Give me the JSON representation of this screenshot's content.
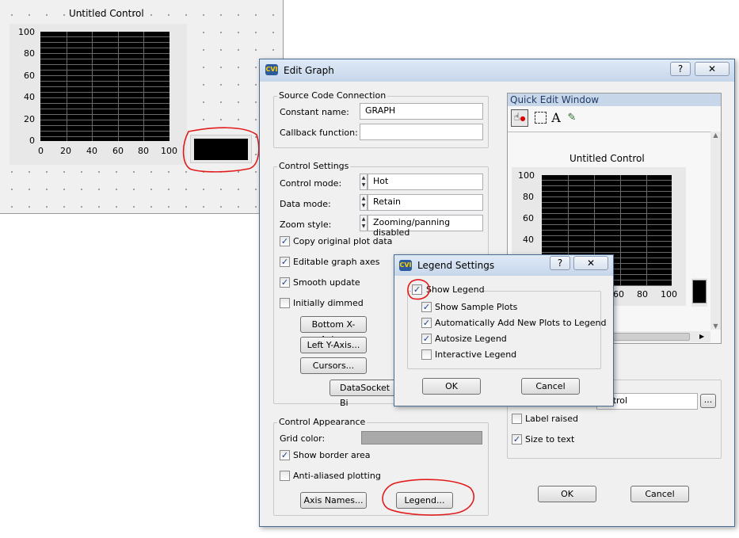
{
  "panel": {
    "control_title": "Untitled Control",
    "y_ticks": [
      "100",
      "80",
      "60",
      "40",
      "20",
      "0"
    ],
    "x_ticks": [
      "0",
      "20",
      "40",
      "60",
      "80",
      "100"
    ]
  },
  "edit_graph": {
    "title": "Edit Graph",
    "help_btn": "?",
    "close_btn": "✕",
    "source_group": "Source Code Connection",
    "constant_label": "Constant name:",
    "constant_value": "GRAPH",
    "callback_label": "Callback function:",
    "callback_value": "",
    "control_settings_group": "Control Settings",
    "control_mode_label": "Control mode:",
    "control_mode_value": "Hot",
    "data_mode_label": "Data mode:",
    "data_mode_value": "Retain",
    "zoom_label": "Zoom style:",
    "zoom_value": "Zooming/panning disabled",
    "cb_copy": "Copy original plot data",
    "cb_editable": "Editable graph axes",
    "cb_smooth": "Smooth update",
    "cb_dimmed": "Initially dimmed",
    "btn_bottom": "Bottom X-Axis...",
    "btn_left": "Left Y-Axis...",
    "btn_cursors": "Cursors...",
    "btn_datasocket": "DataSocket Bi",
    "appearance_group": "Control Appearance",
    "grid_color_label": "Grid color:",
    "cb_border": "Show border area",
    "cb_antialias": "Anti-aliased plotting",
    "btn_axis_names": "Axis Names...",
    "btn_legend": "Legend...",
    "quick_edit_title": "Quick Edit Window",
    "quick_control_title": "Untitled Control",
    "quick_y_ticks": [
      "100",
      "80",
      "60",
      "40"
    ],
    "quick_x_ticks": [
      "60",
      "80",
      "100"
    ],
    "label_value": "ontrol",
    "label_browse": "...",
    "cb_label_raised": "Label raised",
    "cb_size_to_text": "Size to text",
    "btn_ok": "OK",
    "btn_cancel": "Cancel"
  },
  "legend_settings": {
    "title": "Legend Settings",
    "help_btn": "?",
    "close_btn": "✕",
    "show_legend": "Show Legend",
    "show_sample_plots": "Show Sample Plots",
    "auto_add": "Automatically Add New Plots to Legend",
    "autosize": "Autosize Legend",
    "interactive": "Interactive Legend",
    "btn_ok": "OK",
    "btn_cancel": "Cancel"
  },
  "checks": {
    "copy": "✓",
    "editable": "✓",
    "smooth": "✓",
    "dimmed": "",
    "border": "✓",
    "antialias": "",
    "label_raised": "",
    "size_to_text": "✓",
    "show_legend": "✓",
    "sample_plots": "✓",
    "auto_add": "✓",
    "autosize": "✓",
    "interactive": ""
  },
  "colors": {
    "plot_bg": "#000000",
    "grid": "#6a6a6a",
    "annotation": "#e21b1b",
    "title_bar": "#c6d6ea"
  }
}
